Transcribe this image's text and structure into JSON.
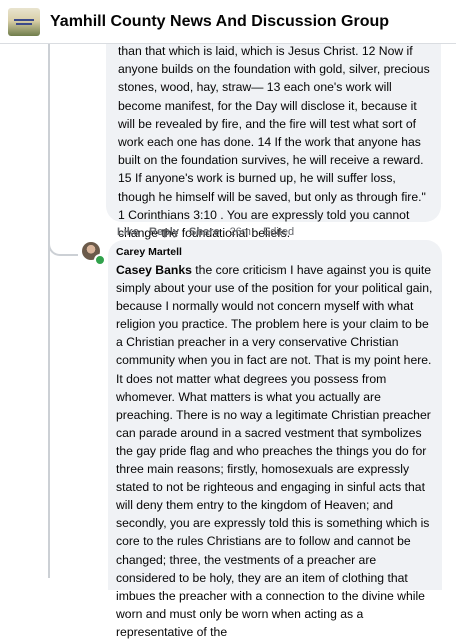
{
  "header": {
    "group_name": "Yamhill County News And Discussion Group"
  },
  "comment1": {
    "text": "than that which is laid, which is Jesus Christ. 12 Now if anyone builds on the foundation with gold, silver, precious stones, wood, hay, straw— 13 each one's work will become manifest, for the Day will disclose it, because it will be revealed by fire, and the fire will test what sort of work each one has done. 14 If the work that anyone has built on the foundation survives, he will receive a reward. 15 If anyone's work is burned up, he will suffer loss, though he himself will be saved, but only as through fire.\" 1 Corinthians 3:10 . You are expressly told you cannot change the foundational beliefs.",
    "actions": {
      "like": "Like",
      "reply": "Reply",
      "share": "Share",
      "time": "26m",
      "edited": "Edited"
    }
  },
  "comment2": {
    "author": "Carey Martell",
    "mention": "Casey Banks",
    "text": " the core criticism I have against you is quite simply about your use of the position for your political gain, because I normally would not concern myself with what religion you practice. The problem here is your claim to be a Christian preacher in a very conservative Christian community when you in fact are not. That is my point here. It does not matter what degrees you possess from whomever. What matters is what you actually are preaching. There is no way a legitimate Christian preacher can parade around in a sacred vestment that symbolizes the gay pride flag and who preaches the things you do for three main reasons; firstly, homosexuals are expressly stated to not be righteous and engaging in sinful acts that will deny them entry to the kingdom of Heaven; and secondly, you are expressly told this is something which is core to the rules Christians are to follow and cannot be changed; three, the vestments of a preacher are considered to be holy, they are an item of clothing that imbues the preacher with a connection to the divine while worn and must only be worn when acting as a representative of the"
  },
  "colors": {
    "bubble": "#f0f2f5",
    "meta_text": "#65676b",
    "thread_line": "#ccd0d5",
    "online": "#31a24c"
  }
}
